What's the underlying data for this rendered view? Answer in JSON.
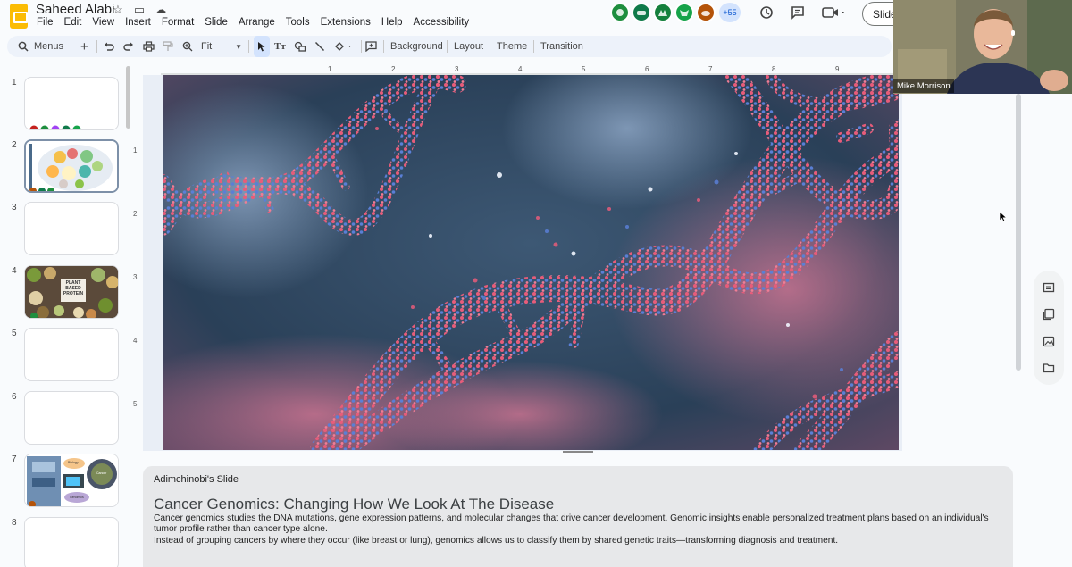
{
  "header": {
    "doc_title": "Saheed Alabi",
    "menu": [
      "File",
      "Edit",
      "View",
      "Insert",
      "Format",
      "Slide",
      "Arrange",
      "Tools",
      "Extensions",
      "Help",
      "Accessibility"
    ],
    "collaborators_more": "+55",
    "slideshow_label": "Slide"
  },
  "toolbar": {
    "menus_label": "Menus",
    "zoom": "Fit",
    "background": "Background",
    "layout": "Layout",
    "theme": "Theme",
    "transition": "Transition"
  },
  "rulers": {
    "horizontal": [
      "1",
      "2",
      "3",
      "4",
      "5",
      "6",
      "7",
      "8",
      "9"
    ],
    "vertical": [
      "1",
      "2",
      "3",
      "4",
      "5"
    ]
  },
  "filmstrip": {
    "slides": [
      "1",
      "2",
      "3",
      "4",
      "5",
      "6",
      "7",
      "8"
    ],
    "thumb4_text": "PLANT BASED PROTEIN",
    "thumb7_labels": [
      "Biology",
      "Cancer",
      "Genomics"
    ]
  },
  "notes": {
    "author": "Adimchinobi's Slide",
    "title": "Cancer Genomics: Changing How We Look At The Disease",
    "para1": "Cancer genomics studies the DNA mutations, gene expression patterns, and molecular changes that drive cancer development. Genomic insights enable personalized treatment plans based on an individual's tumor profile rather than cancer type alone.",
    "para2": "Instead of grouping cancers by where they occur (like breast or lung), genomics allows us to classify them by shared genetic traits—transforming diagnosis and treatment."
  },
  "video": {
    "participant_name": "Mike Morrison"
  },
  "colors": {
    "accent": "#0b57d0",
    "logo": "#fbbc04",
    "dna_pink": "#e0556e",
    "dna_blue": "#5a7fd6"
  }
}
